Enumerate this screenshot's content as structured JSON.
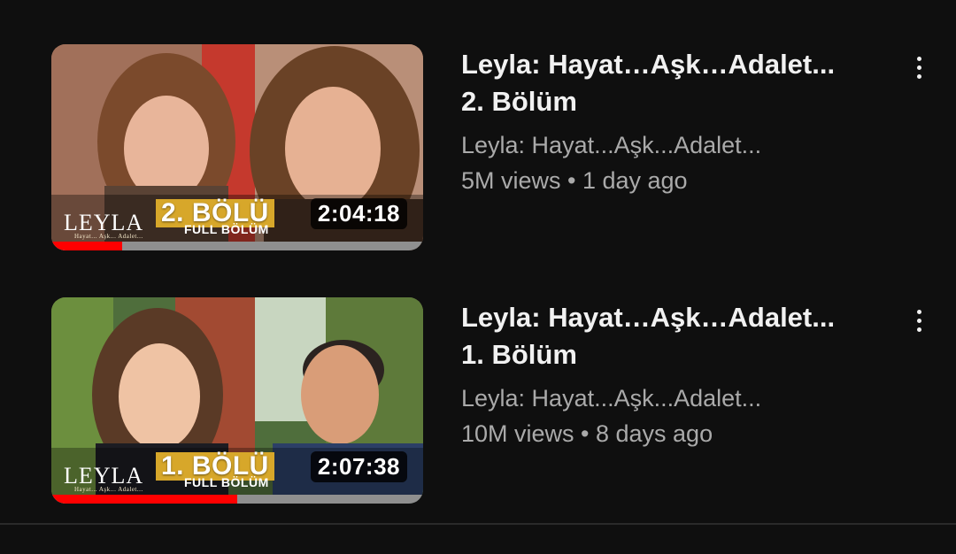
{
  "videos": [
    {
      "title_line1": "Leyla: Hayat…Aşk…Adalet...",
      "title_line2": "2. Bölüm",
      "channel": "Leyla: Hayat...Aşk...Adalet...",
      "stats": "5M views • 1 day ago",
      "duration": "2:04:18",
      "thumbnail": {
        "logo": "LEYLA",
        "logo_sub": "Hayat... Aşk... Adalet...",
        "episode_text": "2. BÖLÜ",
        "full_text": "FULL BÖLÜM"
      },
      "watch_progress": 0.19
    },
    {
      "title_line1": "Leyla: Hayat…Aşk…Adalet...",
      "title_line2": "1. Bölüm",
      "channel": "Leyla: Hayat...Aşk...Adalet...",
      "stats": "10M views • 8 days ago",
      "duration": "2:07:38",
      "thumbnail": {
        "logo": "LEYLA",
        "logo_sub": "Hayat... Aşk... Adalet...",
        "episode_text": "1. BÖLÜ",
        "full_text": "FULL BÖLÜM"
      },
      "watch_progress": 0.5
    }
  ],
  "icons": {
    "menu": "more-vert-icon"
  },
  "colors": {
    "background": "#0f0f0f",
    "progress": "#ff0000",
    "badge": "#d7a72a"
  }
}
